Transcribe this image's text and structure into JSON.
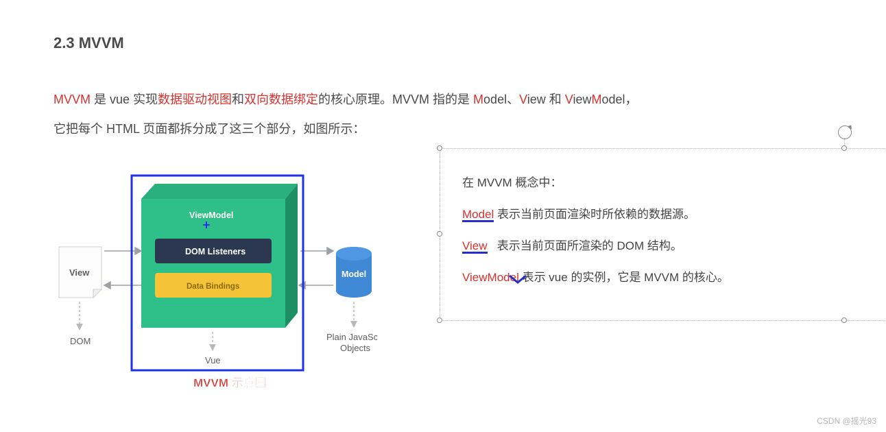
{
  "heading": "2.3 MVVM",
  "intro": {
    "l1_a": "MVVM",
    "l1_b": " 是 vue 实现",
    "l1_c": "数据驱动视图",
    "l1_d": "和",
    "l1_e": "双向数据绑定",
    "l1_f": "的核心原理。MVVM 指的是 ",
    "l1_g": "M",
    "l1_h": "odel、",
    "l1_i": "V",
    "l1_j": "iew 和 ",
    "l1_k": "V",
    "l1_l": "iew",
    "l1_m": "M",
    "l1_n": "odel，",
    "l2": "它把每个 HTML 页面都拆分成了这三个部分，如图所示："
  },
  "diagram": {
    "view": "View",
    "viewmodel": "ViewModel",
    "dom_listeners": "DOM Listeners",
    "data_bindings": "Data Bindings",
    "model": "Model",
    "dom": "DOM",
    "vue": "Vue",
    "pjo1": "Plain JavaScript",
    "pjo2": "Objects",
    "caption": "MVVM 示意图"
  },
  "callouts": {
    "head": "在 MVVM 概念中：",
    "r1a": "Model",
    "r1b": " 表示当前页面渲染时所依赖的数据源。",
    "r2a": "View",
    "r2b": "   表示当前页面所渲染的 DOM 结构。",
    "r3a": "View",
    "r3a2": "Model",
    "r3b": " 表示 vue 的实例，它是 MVVM 的核心。"
  },
  "watermark": "CSDN @摇光93",
  "colors": {
    "red": "#d8322f",
    "blue_annot": "#1c32e6",
    "cube": "#2ec088",
    "cube_dark": "#27a374",
    "listeners": "#2c3850",
    "bindings": "#f5c338",
    "cylinder": "#3f88d6"
  }
}
